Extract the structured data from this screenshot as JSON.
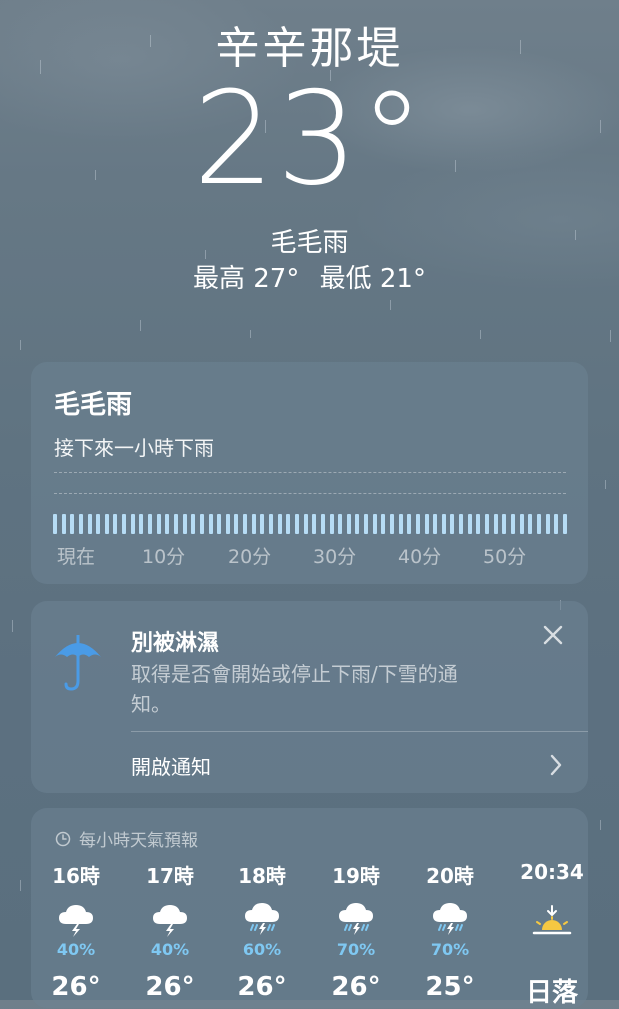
{
  "header": {
    "city": "辛辛那堤",
    "temperature": "23°",
    "condition": "毛毛雨",
    "high": "最高 27°",
    "low": "最低 21°"
  },
  "precip_card": {
    "title": "毛毛雨",
    "subtitle": "接下來一小時下雨",
    "axis_labels": [
      "現在",
      "10分",
      "20分",
      "30分",
      "40分",
      "50分"
    ],
    "bar_color": "#b6dcf5"
  },
  "notify_card": {
    "icon": "umbrella-icon",
    "title": "別被淋濕",
    "description": "取得是否會開始或停止下雨/下雪的通知。",
    "link_label": "開啟通知",
    "accent_color": "#4a9be6"
  },
  "hourly": {
    "header": "每小時天氣預報",
    "items": [
      {
        "time": "16時",
        "icon": "thunderstorm-icon",
        "precip": "40%",
        "temp": "26°"
      },
      {
        "time": "17時",
        "icon": "thunderstorm-icon",
        "precip": "40%",
        "temp": "26°"
      },
      {
        "time": "18時",
        "icon": "thunderstorm-rain-icon",
        "precip": "60%",
        "temp": "26°"
      },
      {
        "time": "19時",
        "icon": "thunderstorm-rain-icon",
        "precip": "70%",
        "temp": "26°"
      },
      {
        "time": "20時",
        "icon": "thunderstorm-rain-icon",
        "precip": "70%",
        "temp": "25°"
      },
      {
        "time": "20:34",
        "icon": "sunset-icon",
        "precip": "",
        "temp": "日落"
      }
    ]
  }
}
